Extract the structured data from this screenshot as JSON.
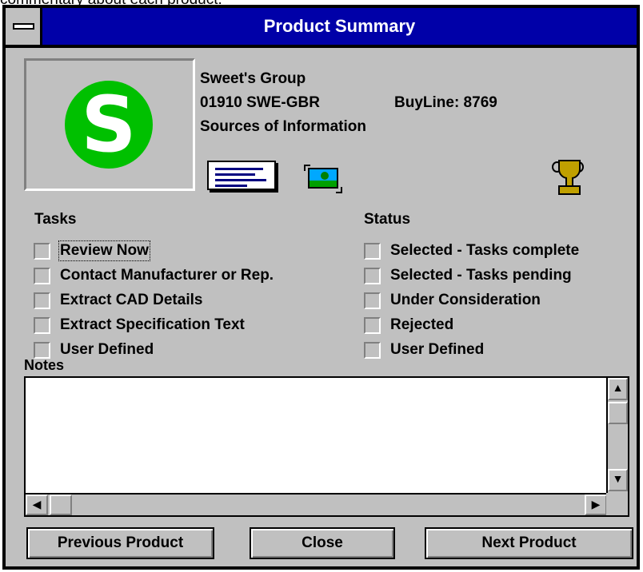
{
  "top_caption": "commentary about each product.",
  "window": {
    "title": "Product Summary"
  },
  "product": {
    "company": "Sweet's Group",
    "code": "01910 SWE-GBR",
    "buyline": "BuyLine: 8769",
    "sources": "Sources of Information",
    "logo_letter": "S"
  },
  "tasks": {
    "label": "Tasks",
    "items": [
      {
        "label": "Review Now",
        "checked": false
      },
      {
        "label": "Contact Manufacturer or Rep.",
        "checked": false
      },
      {
        "label": "Extract CAD Details",
        "checked": false
      },
      {
        "label": "Extract Specification Text",
        "checked": false
      },
      {
        "label": "User Defined",
        "checked": false
      }
    ]
  },
  "status": {
    "label": "Status",
    "items": [
      {
        "label": "Selected - Tasks complete",
        "checked": false
      },
      {
        "label": "Selected - Tasks pending",
        "checked": false
      },
      {
        "label": "Under Consideration",
        "checked": false
      },
      {
        "label": "Rejected",
        "checked": false
      },
      {
        "label": "User Defined",
        "checked": false
      }
    ]
  },
  "notes": {
    "label": "Notes",
    "value": ""
  },
  "buttons": {
    "previous": "Previous Product",
    "close": "Close",
    "next": "Next Product"
  },
  "icons": {
    "document": "document-icon",
    "image": "picture-icon",
    "trophy": "trophy-icon"
  }
}
